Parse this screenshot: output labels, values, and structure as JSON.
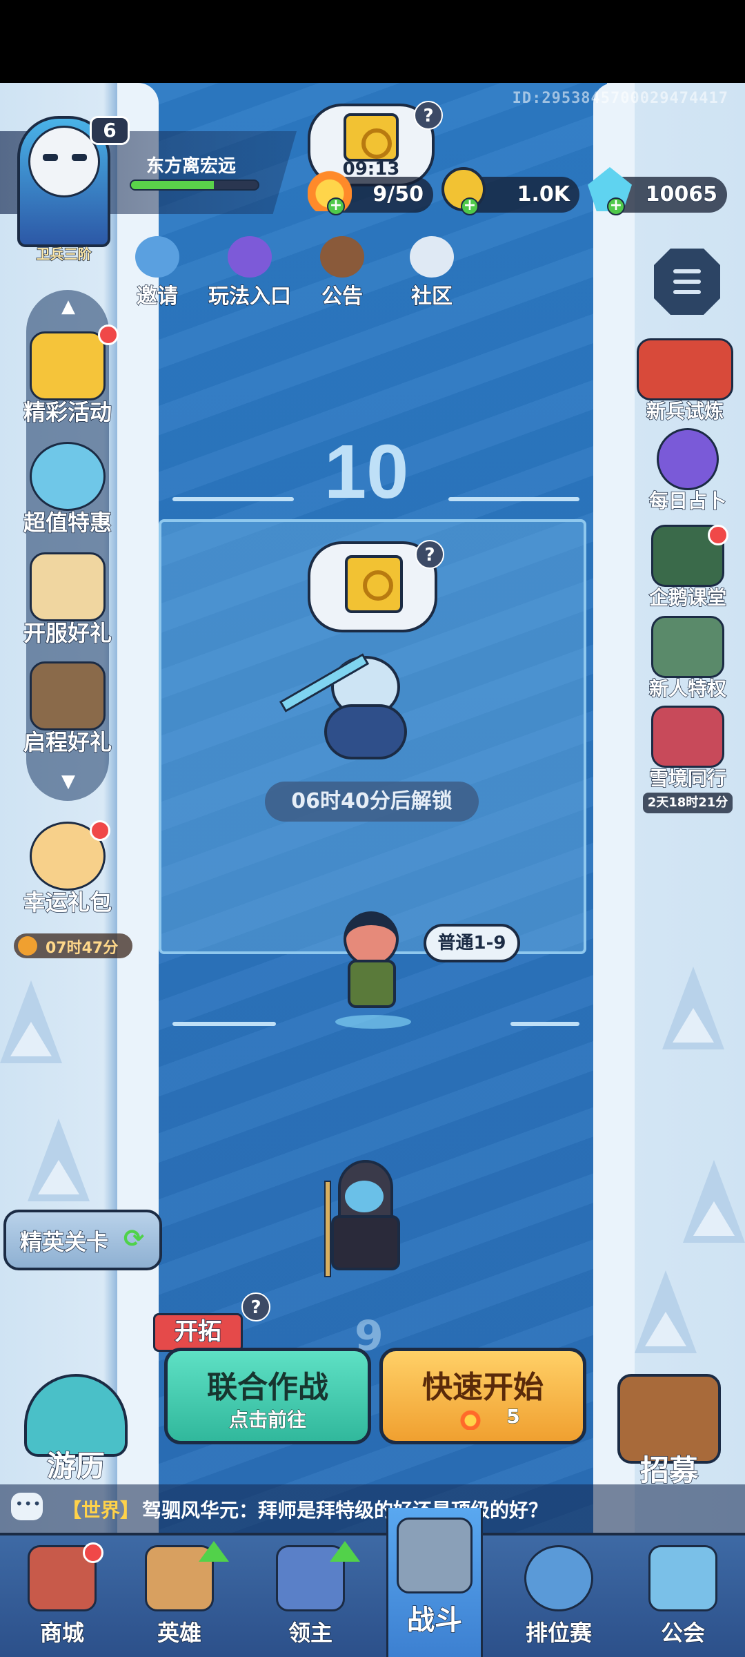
{
  "header": {
    "player_id": "ID:2953845700029474417",
    "player_name": "东方离宏远",
    "level": "6",
    "rank": "卫兵三阶",
    "xp_progress": 0.65
  },
  "resources": {
    "stamina": "9/50",
    "stamina_timer": "09:13",
    "gold": "1.0K",
    "gems": "10065"
  },
  "top_buttons": [
    {
      "label": "邀请"
    },
    {
      "label": "玩法入口"
    },
    {
      "label": "公告"
    },
    {
      "label": "社区"
    }
  ],
  "left_menu": [
    {
      "label": "精彩活动"
    },
    {
      "label": "超值特惠"
    },
    {
      "label": "开服好礼"
    },
    {
      "label": "启程好礼"
    }
  ],
  "lucky_pack": {
    "label": "幸运礼包",
    "timer": "07时47分"
  },
  "right_menu": [
    {
      "label": "新兵试炼"
    },
    {
      "label": "每日占卜"
    },
    {
      "label": "企鹅课堂"
    },
    {
      "label": "新人特权"
    },
    {
      "label": "雪境同行",
      "timer": "2天18时21分"
    }
  ],
  "stage": {
    "number": "10",
    "unlock_text": "06时40分后解锁",
    "difficulty": "普通1-9",
    "next_number": "9"
  },
  "actions": {
    "elite": "精英关卡",
    "explore_tag": "开拓",
    "coop_title": "联合作战",
    "coop_sub": "点击前往",
    "quick_title": "快速开始",
    "quick_cost": "5",
    "travel": "游历",
    "recruit": "招募"
  },
  "chat": {
    "channel": "【世界】",
    "message": "驾驷风华元：拜师是拜特级的好还是顶级的好？"
  },
  "nav": [
    {
      "label": "商城"
    },
    {
      "label": "英雄"
    },
    {
      "label": "领主"
    },
    {
      "label": "战斗"
    },
    {
      "label": "排位赛"
    },
    {
      "label": "公会"
    }
  ],
  "colors": {
    "river": "#2a78c2",
    "snow": "#d4e6f4",
    "accent_gold": "#f2c233",
    "coop": "#3cc8ac",
    "quick": "#f5b640"
  }
}
